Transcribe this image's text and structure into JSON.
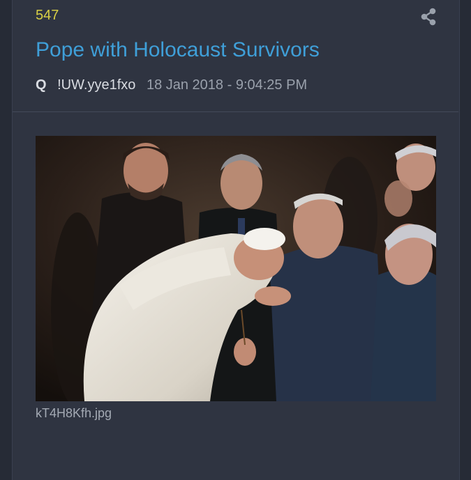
{
  "post": {
    "number": "547",
    "title": "Pope with Holocaust Survivors",
    "author": "Q",
    "tripcode": "!UW.yye1fxo",
    "timestamp": "18 Jan 2018 - 9:04:25 PM"
  },
  "attachment": {
    "filename": "kT4H8Kfh.jpg"
  },
  "icons": {
    "share": "share-icon"
  },
  "colors": {
    "background": "#262b36",
    "card": "#2f3441",
    "post_number": "#d8cf45",
    "title": "#3f9fd8",
    "meta_text": "#d9dce2",
    "timestamp": "#9aa1ac"
  }
}
